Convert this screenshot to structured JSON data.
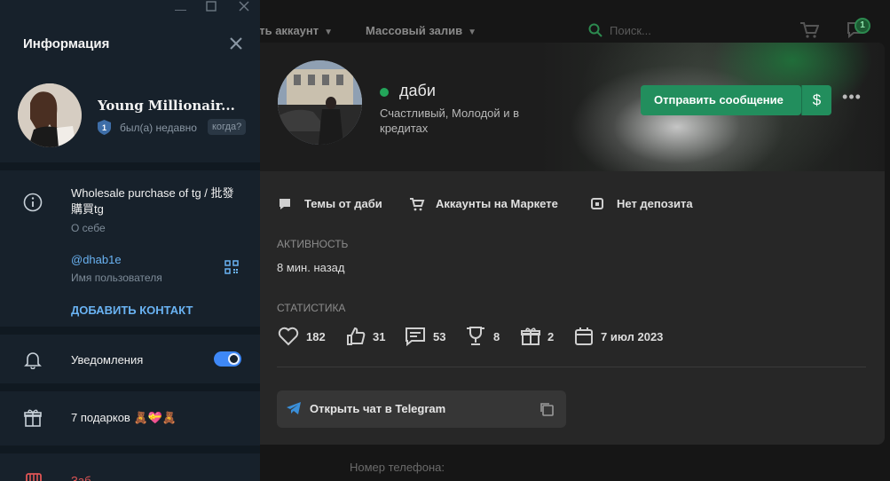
{
  "site": {
    "nav": {
      "link1": "ать аккаунт",
      "link2": "Массовый залив",
      "search_placeholder": "Поиск...",
      "chat_badge": "1"
    },
    "profile": {
      "name": "даби",
      "status": "Счастливый, Молодой и в кредитах",
      "send_message": "Отправить сообщение",
      "money_symbol": "$",
      "more": "•••",
      "links": [
        {
          "icon": "speech-bubble-icon",
          "label": "Темы от даби"
        },
        {
          "icon": "cart-icon",
          "label": "Аккаунты на Маркете"
        },
        {
          "icon": "deposit-icon",
          "label": "Нет депозита"
        }
      ],
      "activity_label": "Активность",
      "activity_value": "8 мин. назад",
      "stats_label": "Статистика",
      "stats": [
        {
          "icon": "heart-icon",
          "value": "182"
        },
        {
          "icon": "thumbs-up-icon",
          "value": "31"
        },
        {
          "icon": "message-icon",
          "value": "53"
        },
        {
          "icon": "trophy-icon",
          "value": "8"
        },
        {
          "icon": "gift-icon",
          "value": "2"
        },
        {
          "icon": "calendar-icon",
          "value": "7 июл 2023"
        }
      ],
      "open_telegram": "Открыть чат в Telegram",
      "phone_label": "Номер телефона:"
    }
  },
  "telegram": {
    "header": "Информация",
    "name": "Young Millionair...",
    "shield_num": "1",
    "last_seen": "был(а) недавно",
    "when": "когда?",
    "bio": "Wholesale purchase of tg / 批發購買tg",
    "bio_label": "О себе",
    "username": "@dhab1e",
    "username_label": "Имя пользователя",
    "add_contact": "ДОБАВИТЬ КОНТАКТ",
    "notifications": "Уведомления",
    "notifications_on": true,
    "gifts": "7 подарков 🧸💝🧸",
    "danger_partial": "Заб..."
  },
  "colors": {
    "accent_green": "#228e5d",
    "tg_blue": "#6ab3f3",
    "tg_bg": "#17212b",
    "online": "#23a55a"
  }
}
